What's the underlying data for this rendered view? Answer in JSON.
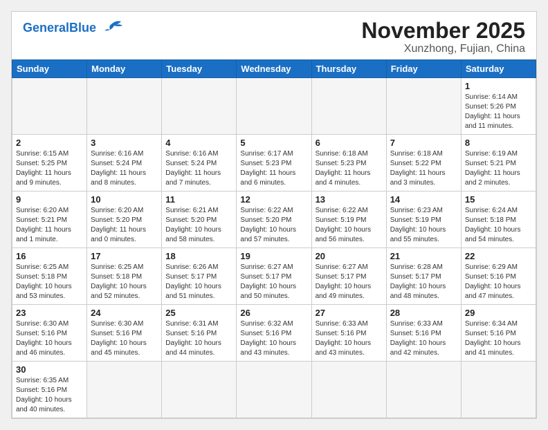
{
  "header": {
    "logo_general": "General",
    "logo_blue": "Blue",
    "month": "November 2025",
    "location": "Xunzhong, Fujian, China"
  },
  "weekdays": [
    "Sunday",
    "Monday",
    "Tuesday",
    "Wednesday",
    "Thursday",
    "Friday",
    "Saturday"
  ],
  "weeks": [
    [
      {
        "day": "",
        "info": ""
      },
      {
        "day": "",
        "info": ""
      },
      {
        "day": "",
        "info": ""
      },
      {
        "day": "",
        "info": ""
      },
      {
        "day": "",
        "info": ""
      },
      {
        "day": "",
        "info": ""
      },
      {
        "day": "1",
        "info": "Sunrise: 6:14 AM\nSunset: 5:26 PM\nDaylight: 11 hours and 11 minutes."
      }
    ],
    [
      {
        "day": "2",
        "info": "Sunrise: 6:15 AM\nSunset: 5:25 PM\nDaylight: 11 hours and 9 minutes."
      },
      {
        "day": "3",
        "info": "Sunrise: 6:16 AM\nSunset: 5:24 PM\nDaylight: 11 hours and 8 minutes."
      },
      {
        "day": "4",
        "info": "Sunrise: 6:16 AM\nSunset: 5:24 PM\nDaylight: 11 hours and 7 minutes."
      },
      {
        "day": "5",
        "info": "Sunrise: 6:17 AM\nSunset: 5:23 PM\nDaylight: 11 hours and 6 minutes."
      },
      {
        "day": "6",
        "info": "Sunrise: 6:18 AM\nSunset: 5:23 PM\nDaylight: 11 hours and 4 minutes."
      },
      {
        "day": "7",
        "info": "Sunrise: 6:18 AM\nSunset: 5:22 PM\nDaylight: 11 hours and 3 minutes."
      },
      {
        "day": "8",
        "info": "Sunrise: 6:19 AM\nSunset: 5:21 PM\nDaylight: 11 hours and 2 minutes."
      }
    ],
    [
      {
        "day": "9",
        "info": "Sunrise: 6:20 AM\nSunset: 5:21 PM\nDaylight: 11 hours and 1 minute."
      },
      {
        "day": "10",
        "info": "Sunrise: 6:20 AM\nSunset: 5:20 PM\nDaylight: 11 hours and 0 minutes."
      },
      {
        "day": "11",
        "info": "Sunrise: 6:21 AM\nSunset: 5:20 PM\nDaylight: 10 hours and 58 minutes."
      },
      {
        "day": "12",
        "info": "Sunrise: 6:22 AM\nSunset: 5:20 PM\nDaylight: 10 hours and 57 minutes."
      },
      {
        "day": "13",
        "info": "Sunrise: 6:22 AM\nSunset: 5:19 PM\nDaylight: 10 hours and 56 minutes."
      },
      {
        "day": "14",
        "info": "Sunrise: 6:23 AM\nSunset: 5:19 PM\nDaylight: 10 hours and 55 minutes."
      },
      {
        "day": "15",
        "info": "Sunrise: 6:24 AM\nSunset: 5:18 PM\nDaylight: 10 hours and 54 minutes."
      }
    ],
    [
      {
        "day": "16",
        "info": "Sunrise: 6:25 AM\nSunset: 5:18 PM\nDaylight: 10 hours and 53 minutes."
      },
      {
        "day": "17",
        "info": "Sunrise: 6:25 AM\nSunset: 5:18 PM\nDaylight: 10 hours and 52 minutes."
      },
      {
        "day": "18",
        "info": "Sunrise: 6:26 AM\nSunset: 5:17 PM\nDaylight: 10 hours and 51 minutes."
      },
      {
        "day": "19",
        "info": "Sunrise: 6:27 AM\nSunset: 5:17 PM\nDaylight: 10 hours and 50 minutes."
      },
      {
        "day": "20",
        "info": "Sunrise: 6:27 AM\nSunset: 5:17 PM\nDaylight: 10 hours and 49 minutes."
      },
      {
        "day": "21",
        "info": "Sunrise: 6:28 AM\nSunset: 5:17 PM\nDaylight: 10 hours and 48 minutes."
      },
      {
        "day": "22",
        "info": "Sunrise: 6:29 AM\nSunset: 5:16 PM\nDaylight: 10 hours and 47 minutes."
      }
    ],
    [
      {
        "day": "23",
        "info": "Sunrise: 6:30 AM\nSunset: 5:16 PM\nDaylight: 10 hours and 46 minutes."
      },
      {
        "day": "24",
        "info": "Sunrise: 6:30 AM\nSunset: 5:16 PM\nDaylight: 10 hours and 45 minutes."
      },
      {
        "day": "25",
        "info": "Sunrise: 6:31 AM\nSunset: 5:16 PM\nDaylight: 10 hours and 44 minutes."
      },
      {
        "day": "26",
        "info": "Sunrise: 6:32 AM\nSunset: 5:16 PM\nDaylight: 10 hours and 43 minutes."
      },
      {
        "day": "27",
        "info": "Sunrise: 6:33 AM\nSunset: 5:16 PM\nDaylight: 10 hours and 43 minutes."
      },
      {
        "day": "28",
        "info": "Sunrise: 6:33 AM\nSunset: 5:16 PM\nDaylight: 10 hours and 42 minutes."
      },
      {
        "day": "29",
        "info": "Sunrise: 6:34 AM\nSunset: 5:16 PM\nDaylight: 10 hours and 41 minutes."
      }
    ],
    [
      {
        "day": "30",
        "info": "Sunrise: 6:35 AM\nSunset: 5:16 PM\nDaylight: 10 hours and 40 minutes."
      },
      {
        "day": "",
        "info": ""
      },
      {
        "day": "",
        "info": ""
      },
      {
        "day": "",
        "info": ""
      },
      {
        "day": "",
        "info": ""
      },
      {
        "day": "",
        "info": ""
      },
      {
        "day": "",
        "info": ""
      }
    ]
  ]
}
